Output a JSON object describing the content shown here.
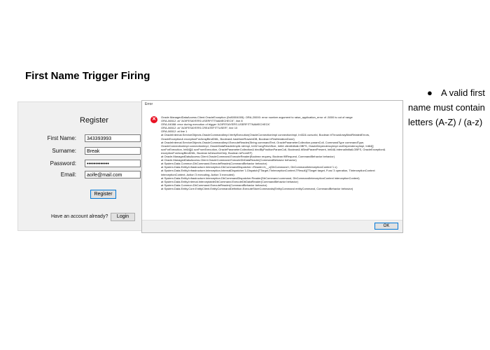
{
  "slide": {
    "title": "First Name Trigger Firing",
    "bullet_text": "A valid first name must contain letters (A-Z) / (a-z)"
  },
  "register_form": {
    "title": "Register",
    "fields": [
      {
        "label": "First Name:",
        "value": "343393993"
      },
      {
        "label": "Surname:",
        "value": "Break"
      },
      {
        "label": "Password:",
        "value": "•••••••••••••"
      },
      {
        "label": "Email:",
        "value": "aoife@mail.com"
      }
    ],
    "register_label": "Register",
    "account_prompt": "Have an account already?",
    "login_label": "Login"
  },
  "error_dialog": {
    "caption": "Error",
    "lines": [
      "Oracle.ManagedDataAccess.Client.OracleException (0x80004005): ORA-20000: error number argument to raise_application_error of -5000 is out of range",
      "ORA-06512: at \"AOIFESAYERS.USERFITTNAMECHECK\", line 8",
      "ORA-04088: error during execution of trigger 'AOIFESAYERS.USERFITTNAMECHECK'",
      "ORA-06512: at \"AOIFESAYERS.CREATEFITTUSER\", line 10",
      "ORA-06512: at line 1",
      "   at OracleInternal.ServiceObjects.OracleCommandImpl.VerifyExecution(OracleConnectionImpl connectionImpl, Int32& cursorId, Boolean bThrowArrayBindRelatedErrors, OracleException& exceptionForArrayBindDML, Boolean& hasMoreRowsInDB, Boolean bFirstIterationDone)",
      "   at OracleInternal.ServiceObjects.OracleCommandImpl.ExecuteReader(String commandText, OracleParameterCollection paramColl, CommandType commandType, OracleConnectionImpl connectionImpl, OracleDataReaderImpl& rdrImpl, Int32 longFetchSize, Int64 clientInitialLOBFS, OracleDependencyImpl orclDependencyImpl, Int64[] scnForExecution, Int64[]& scnFromExecution, OracleParameterCollection& bindByPositionParamColl, Boolean& bBindParamPresent, Int64& internalInitialLOBFS, OracleException& exceptionForArrayBindDML, Boolean isDescribeOnly, Boolean isFromEF)",
      "   at Oracle.ManagedDataAccess.Client.OracleCommand.ExecuteReader(Boolean requery, Boolean fillRequest, CommandBehavior behavior)",
      "   at Oracle.ManagedDataAccess.Client.OracleCommand.ExecuteDbDataReader(CommandBehavior behavior)",
      "   at System.Data.Common.DbCommand.ExecuteReader(CommandBehavior behavior)",
      "   at System.Data.Entity.Infrastructure.Interception.DbCommandDispatcher.<Reader>b__c(DbCommand t, DbCommandInterceptionContext`1 c)",
      "   at System.Data.Entity.Infrastructure.Interception.InternalDispatcher`1.Dispatch[TTarget,TInterceptionContext,TResult](TTarget target, Func`3 operation, TInterceptionContext interceptionContext, Action`3 executing, Action`3 executed)",
      "   at System.Data.Entity.Infrastructure.Interception.DbCommandDispatcher.Reader(DbCommand command, DbCommandInterceptionContext interceptionContext)",
      "   at System.Data.Entity.Internal.InterceptableDbCommand.ExecuteDbDataReader(CommandBehavior behavior)",
      "   at System.Data.Common.DbCommand.ExecuteReader(CommandBehavior behavior)",
      "   at System.Data.Entity.Core.EntityClient.EntityCommandDefinition.ExecuteStoreCommands(EntityCommand entityCommand, CommandBehavior behavior)"
    ],
    "ok_label": "OK"
  }
}
